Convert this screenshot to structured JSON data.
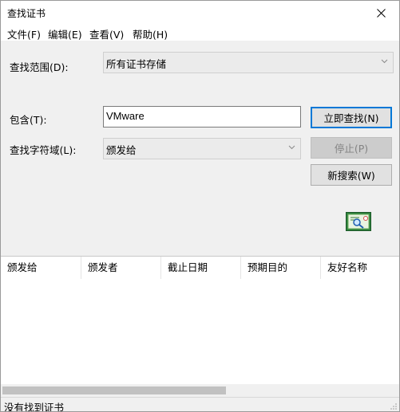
{
  "window": {
    "title": "查找证书",
    "close_glyph": "✕"
  },
  "menu": [
    "文件(F)",
    "编辑(E)",
    "查看(V)",
    "帮助(H)"
  ],
  "scope": {
    "label": "查找范围(D):",
    "value": "所有证书存储"
  },
  "contains": {
    "label": "包含(T):",
    "value": "VMware"
  },
  "field": {
    "label": "查找字符域(L):",
    "value": "颁发给"
  },
  "buttons": {
    "find_now": "立即查找(N)",
    "stop": "停止(P)",
    "new_search": "新搜索(W)"
  },
  "columns": [
    "颁发给",
    "颁发者",
    "截止日期",
    "预期目的",
    "友好名称"
  ],
  "status": "没有找到证书",
  "colors": {
    "accent": "#0078d7",
    "disabled_text": "#838383"
  }
}
